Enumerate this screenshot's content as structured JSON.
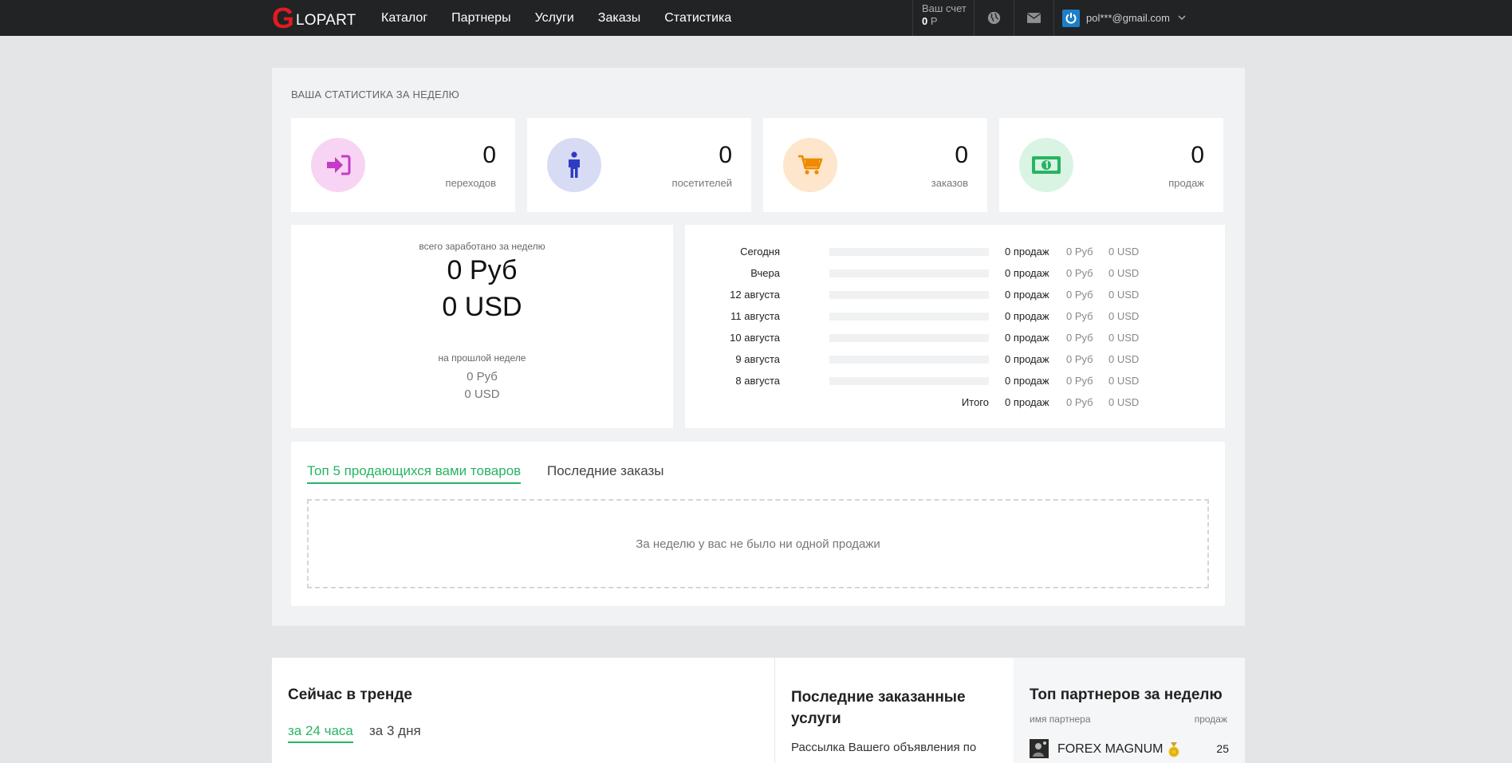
{
  "header": {
    "logo_letter": "G",
    "logo_text": "LOPART",
    "nav": [
      "Каталог",
      "Партнеры",
      "Услуги",
      "Заказы",
      "Статистика"
    ],
    "account_label": "Ваш счет",
    "account_value": "0",
    "account_currency": "Р",
    "user_email": "pol***@gmail.com",
    "icons": [
      "globe-icon",
      "mail-icon",
      "power-icon",
      "chevron-down-icon"
    ]
  },
  "stats": {
    "title": "ВАША СТАТИСТИКА ЗА НЕДЕЛЮ",
    "cards": [
      {
        "value": "0",
        "label": "переходов",
        "icon": "sign-in-icon",
        "color": "#c63ac6",
        "bg": "#f7d4f3"
      },
      {
        "value": "0",
        "label": "посетителей",
        "icon": "person-icon",
        "color": "#2f3bc3",
        "bg": "#d7dbf4"
      },
      {
        "value": "0",
        "label": "заказов",
        "icon": "cart-icon",
        "color": "#f08a00",
        "bg": "#fde6cc"
      },
      {
        "value": "0",
        "label": "продаж",
        "icon": "money-icon",
        "color": "#28b463",
        "bg": "#d9f4e3"
      }
    ],
    "earned_label": "всего заработано за неделю",
    "earned_rub": "0 Руб",
    "earned_usd": "0 USD",
    "last_week_label": "на прошлой неделе",
    "last_week_rub": "0 Руб",
    "last_week_usd": "0 USD",
    "days": [
      {
        "name": "Сегодня",
        "sales": "0 продаж",
        "rub": "0 Руб",
        "usd": "0 USD",
        "share": 0
      },
      {
        "name": "Вчера",
        "sales": "0 продаж",
        "rub": "0 Руб",
        "usd": "0 USD",
        "share": 0
      },
      {
        "name": "12 августа",
        "sales": "0 продаж",
        "rub": "0 Руб",
        "usd": "0 USD",
        "share": 0
      },
      {
        "name": "11 августа",
        "sales": "0 продаж",
        "rub": "0 Руб",
        "usd": "0 USD",
        "share": 0
      },
      {
        "name": "10 августа",
        "sales": "0 продаж",
        "rub": "0 Руб",
        "usd": "0 USD",
        "share": 0
      },
      {
        "name": "9 августа",
        "sales": "0 продаж",
        "rub": "0 Руб",
        "usd": "0 USD",
        "share": 0
      },
      {
        "name": "8 августа",
        "sales": "0 продаж",
        "rub": "0 Руб",
        "usd": "0 USD",
        "share": 0
      }
    ],
    "total": {
      "name": "Итого",
      "sales": "0 продаж",
      "rub": "0 Руб",
      "usd": "0 USD"
    },
    "tabs": [
      "Топ 5 продающихся вами товаров",
      "Последние заказы"
    ],
    "empty_message": "За неделю у вас не было ни одной продажи"
  },
  "trend": {
    "title": "Сейчас в тренде",
    "tabs": [
      "за 24 часа",
      "за 3 дня"
    ]
  },
  "services": {
    "title": "Последние заказанные услуги",
    "first_item": "Рассылка Вашего объявления по"
  },
  "partners": {
    "title": "Топ партнеров за неделю",
    "col_name": "имя партнера",
    "col_sales": "продаж",
    "rows": [
      {
        "name": "FOREX MAGNUM",
        "sales": "25"
      }
    ]
  },
  "colors": {
    "accent": "#28b463",
    "header_bg": "#222325",
    "logo_red": "#e11b22"
  }
}
